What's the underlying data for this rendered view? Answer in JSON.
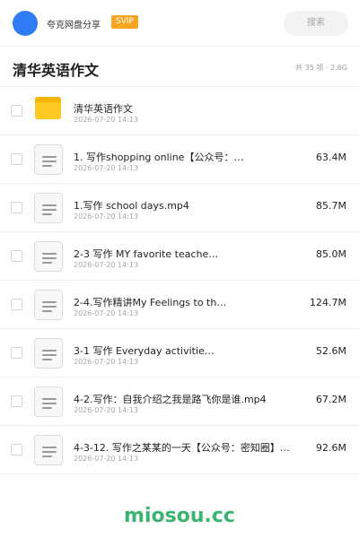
{
  "header": {
    "app_name": "夸克网盘分享",
    "badge": "SVIP",
    "search_label": "搜索"
  },
  "folder": {
    "title": "清华英语作文",
    "stats": "共 35 项 · 2.6G"
  },
  "items": [
    {
      "type": "folder",
      "name": "清华英语作文",
      "date": "2026-07-20 14:13",
      "size": ""
    },
    {
      "type": "file",
      "name": "1. 写作shopping online【公众号：…",
      "date": "2026-07-20 14:13",
      "size": "63.4M"
    },
    {
      "type": "file",
      "name": "1.写作 school days.mp4",
      "date": "2026-07-20 14:13",
      "size": "85.7M"
    },
    {
      "type": "file",
      "name": "2-3 写作 MY favorite teache…",
      "date": "2026-07-20 14:13",
      "size": "85.0M"
    },
    {
      "type": "file",
      "name": "2-4.写作精讲My Feelings to th…",
      "date": "2026-07-20 14:13",
      "size": "124.7M"
    },
    {
      "type": "file",
      "name": "3-1 写作 Everyday activitie…",
      "date": "2026-07-20 14:13",
      "size": "52.6M"
    },
    {
      "type": "file",
      "name": "4-2.写作：自我介绍之我是路飞你是谁.mp4",
      "date": "2026-07-20 14:13",
      "size": "67.2M"
    },
    {
      "type": "file",
      "name": "4-3-12. 写作之某某的一天【公众号：密知圈】…",
      "date": "2026-07-20 14:13",
      "size": "92.6M"
    }
  ],
  "watermark": "miosou.cc",
  "colors": {
    "avatar": "#2f7cf6",
    "badge": "#f6a623",
    "folder": "#ffc924",
    "watermark": "#3cb371"
  }
}
